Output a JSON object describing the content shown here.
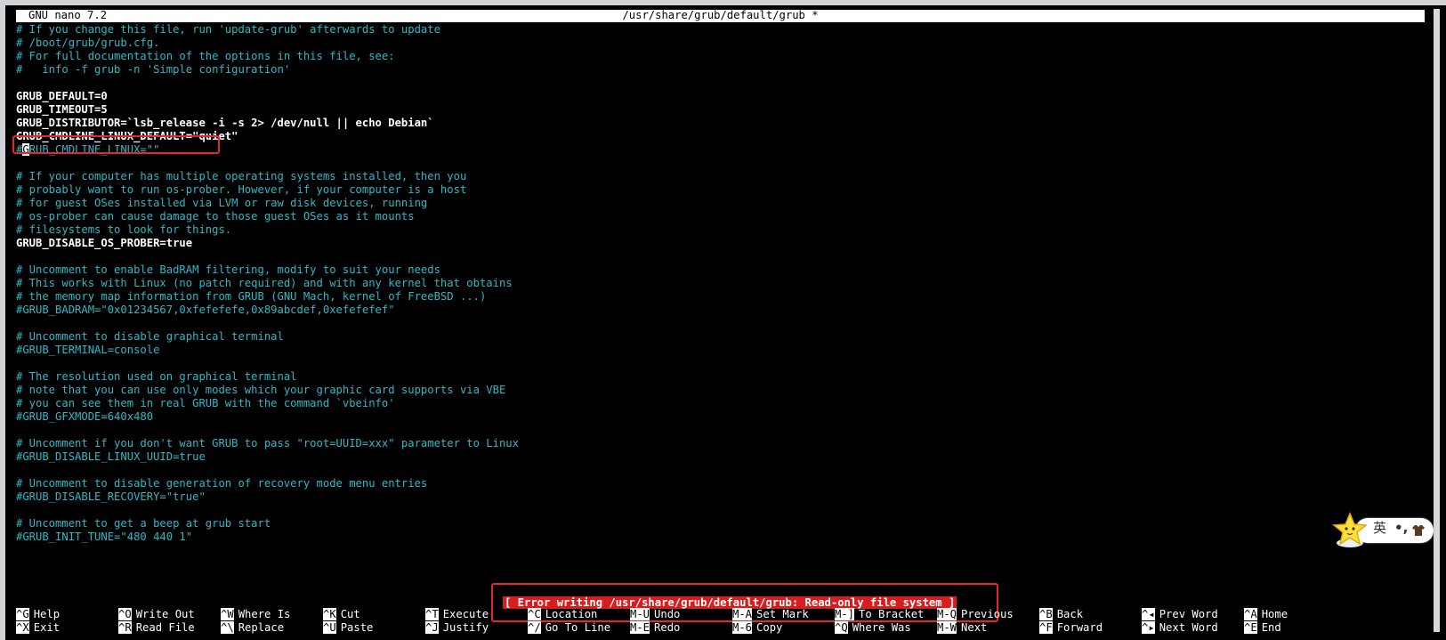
{
  "titlebar": {
    "app_name": "GNU nano 7.2",
    "file_name": "/usr/share/grub/default/grub *"
  },
  "editor": {
    "lines": [
      {
        "type": "comment",
        "text": "# If you change this file, run 'update-grub' afterwards to update"
      },
      {
        "type": "comment",
        "text": "# /boot/grub/grub.cfg."
      },
      {
        "type": "comment",
        "text": "# For full documentation of the options in this file, see:"
      },
      {
        "type": "comment",
        "text": "#   info -f grub -n 'Simple configuration'"
      },
      {
        "type": "blank",
        "text": ""
      },
      {
        "type": "code",
        "text": "GRUB_DEFAULT=0"
      },
      {
        "type": "code",
        "text": "GRUB_TIMEOUT=5"
      },
      {
        "type": "code",
        "text": "GRUB_DISTRIBUTOR=`lsb_release -i -s 2> /dev/null || echo Debian`"
      },
      {
        "type": "code",
        "text": "GRUB_CMDLINE_LINUX_DEFAULT=\"quiet\""
      },
      {
        "type": "cursor",
        "pre": "#",
        "cur": "G",
        "post": "RUB_CMDLINE_LINUX=\"\""
      },
      {
        "type": "blank",
        "text": ""
      },
      {
        "type": "comment",
        "text": "# If your computer has multiple operating systems installed, then you"
      },
      {
        "type": "comment",
        "text": "# probably want to run os-prober. However, if your computer is a host"
      },
      {
        "type": "comment",
        "text": "# for guest OSes installed via LVM or raw disk devices, running"
      },
      {
        "type": "comment",
        "text": "# os-prober can cause damage to those guest OSes as it mounts"
      },
      {
        "type": "comment",
        "text": "# filesystems to look for things."
      },
      {
        "type": "code",
        "text": "GRUB_DISABLE_OS_PROBER=true"
      },
      {
        "type": "blank",
        "text": ""
      },
      {
        "type": "comment",
        "text": "# Uncomment to enable BadRAM filtering, modify to suit your needs"
      },
      {
        "type": "comment",
        "text": "# This works with Linux (no patch required) and with any kernel that obtains"
      },
      {
        "type": "comment",
        "text": "# the memory map information from GRUB (GNU Mach, kernel of FreeBSD ...)"
      },
      {
        "type": "comment",
        "text": "#GRUB_BADRAM=\"0x01234567,0xfefefefe,0x89abcdef,0xefefefef\""
      },
      {
        "type": "blank",
        "text": ""
      },
      {
        "type": "comment",
        "text": "# Uncomment to disable graphical terminal"
      },
      {
        "type": "comment",
        "text": "#GRUB_TERMINAL=console"
      },
      {
        "type": "blank",
        "text": ""
      },
      {
        "type": "comment",
        "text": "# The resolution used on graphical terminal"
      },
      {
        "type": "comment",
        "text": "# note that you can use only modes which your graphic card supports via VBE"
      },
      {
        "type": "comment",
        "text": "# you can see them in real GRUB with the command `vbeinfo'"
      },
      {
        "type": "comment",
        "text": "#GRUB_GFXMODE=640x480"
      },
      {
        "type": "blank",
        "text": ""
      },
      {
        "type": "comment",
        "text": "# Uncomment if you don't want GRUB to pass \"root=UUID=xxx\" parameter to Linux"
      },
      {
        "type": "comment",
        "text": "#GRUB_DISABLE_LINUX_UUID=true"
      },
      {
        "type": "blank",
        "text": ""
      },
      {
        "type": "comment",
        "text": "# Uncomment to disable generation of recovery mode menu entries"
      },
      {
        "type": "comment",
        "text": "#GRUB_DISABLE_RECOVERY=\"true\""
      },
      {
        "type": "blank",
        "text": ""
      },
      {
        "type": "comment",
        "text": "# Uncomment to get a beep at grub start"
      },
      {
        "type": "comment",
        "text": "#GRUB_INIT_TUNE=\"480 440 1\""
      }
    ]
  },
  "status_message": "[ Error writing /usr/share/grub/default/grub: Read-only file system ]",
  "shortcuts": {
    "row1": [
      {
        "key": "^G",
        "label": "Help"
      },
      {
        "key": "^O",
        "label": "Write Out"
      },
      {
        "key": "^W",
        "label": "Where Is"
      },
      {
        "key": "^K",
        "label": "Cut"
      },
      {
        "key": "^T",
        "label": "Execute"
      },
      {
        "key": "^C",
        "label": "Location"
      },
      {
        "key": "M-U",
        "label": "Undo"
      },
      {
        "key": "M-A",
        "label": "Set Mark"
      },
      {
        "key": "M-]",
        "label": "To Bracket"
      },
      {
        "key": "M-Q",
        "label": "Previous"
      },
      {
        "key": "^B",
        "label": "Back"
      },
      {
        "key": "^◂",
        "label": "Prev Word"
      },
      {
        "key": "^A",
        "label": "Home"
      }
    ],
    "row2": [
      {
        "key": "^X",
        "label": "Exit"
      },
      {
        "key": "^R",
        "label": "Read File"
      },
      {
        "key": "^\\",
        "label": "Replace"
      },
      {
        "key": "^U",
        "label": "Paste"
      },
      {
        "key": "^J",
        "label": "Justify"
      },
      {
        "key": "^/",
        "label": "Go To Line"
      },
      {
        "key": "M-E",
        "label": "Redo"
      },
      {
        "key": "M-6",
        "label": "Copy"
      },
      {
        "key": "^Q",
        "label": "Where Was"
      },
      {
        "key": "M-W",
        "label": "Next"
      },
      {
        "key": "^F",
        "label": "Forward"
      },
      {
        "key": "^▸",
        "label": "Next Word"
      },
      {
        "key": "^E",
        "label": "End"
      }
    ]
  },
  "ime": {
    "mode_char": "英",
    "punct": "•,",
    "icon": "shirt-icon"
  },
  "colors": {
    "comment": "#2fb8c7",
    "highlight_box": "#e8262e",
    "status_bg": "#d81d1d"
  }
}
